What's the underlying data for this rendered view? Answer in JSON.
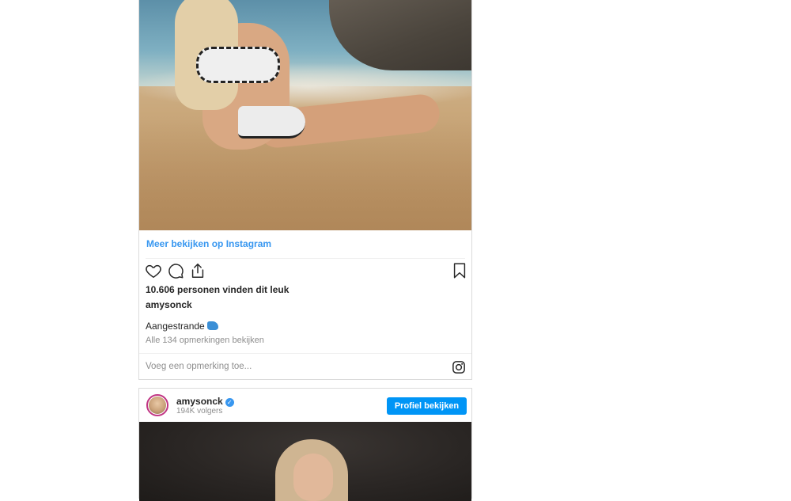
{
  "post1": {
    "more_link": "Meer bekijken op Instagram",
    "likes": "10.606 personen vinden dit leuk",
    "username": "amysonck",
    "caption": "Aangestrande",
    "comments_link": "Alle 134 opmerkingen bekijken",
    "comment_placeholder": "Voeg een opmerking toe...",
    "icons": [
      "heart-icon",
      "comment-icon",
      "share-icon",
      "bookmark-icon",
      "instagram-icon"
    ]
  },
  "post2": {
    "username": "amysonck",
    "followers": "194K volgers",
    "profile_button": "Profiel bekijken"
  },
  "colors": {
    "link": "#3897f0",
    "button": "#0095f6",
    "border": "#dbdbdb",
    "muted": "#8e8e8e",
    "text": "#262626"
  }
}
